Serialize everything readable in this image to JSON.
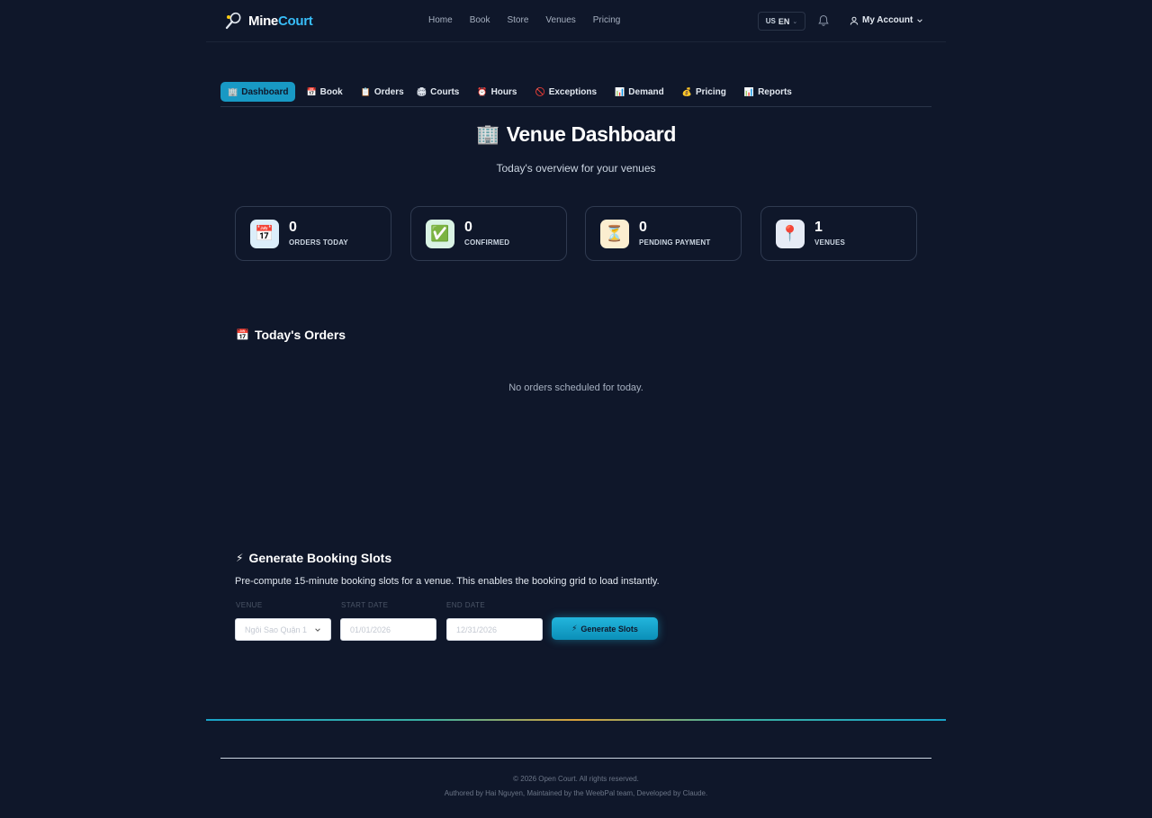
{
  "header": {
    "logo_part1": "Mine",
    "logo_part2": "Court",
    "nav": [
      "Home",
      "Book",
      "Store",
      "Venues",
      "Pricing"
    ],
    "lang_flag": "US",
    "lang_code": "EN",
    "account_label": "My Account"
  },
  "tabs": [
    {
      "icon": "🏢",
      "label": "Dashboard",
      "active": true
    },
    {
      "icon": "📅",
      "label": "Book"
    },
    {
      "icon": "📋",
      "label": "Orders"
    },
    {
      "icon": "🏟",
      "label": "Courts"
    },
    {
      "icon": "⏰",
      "label": "Hours"
    },
    {
      "icon": "🚫",
      "label": "Exceptions"
    },
    {
      "icon": "📊",
      "label": "Demand"
    },
    {
      "icon": "💰",
      "label": "Pricing"
    },
    {
      "icon": "📊",
      "label": "Reports"
    }
  ],
  "page": {
    "title_icon": "🏢",
    "title": "Venue Dashboard",
    "subtitle": "Today's overview for your venues"
  },
  "stats": [
    {
      "icon": "📅",
      "value": "0",
      "label": "ORDERS TODAY",
      "bg": "#dceefa"
    },
    {
      "icon": "✅",
      "value": "0",
      "label": "CONFIRMED",
      "bg": "#d9f3e4"
    },
    {
      "icon": "⏳",
      "value": "0",
      "label": "PENDING PAYMENT",
      "bg": "#fbeed0"
    },
    {
      "icon": "📍",
      "value": "1",
      "label": "VENUES",
      "bg": "#e6ebf5"
    }
  ],
  "orders": {
    "icon": "📅",
    "heading": "Today's Orders",
    "empty_text": "No orders scheduled for today."
  },
  "generate": {
    "icon": "⚡",
    "heading": "Generate Booking Slots",
    "description": "Pre-compute 15-minute booking slots for a venue. This enables the booking grid to load instantly.",
    "venue_label": "VENUE",
    "venue_value": "Ngôi Sao Quận 1",
    "start_label": "START DATE",
    "start_value": "01/01/2026",
    "end_label": "END DATE",
    "end_value": "12/31/2026",
    "button_icon": "⚡",
    "button_label": "Generate Slots"
  },
  "footer": {
    "copyright": "© 2026 Open Court. All rights reserved.",
    "credit": "Authored by Hai Nguyen, Maintained by the WeebPal team, Developed by Claude."
  }
}
